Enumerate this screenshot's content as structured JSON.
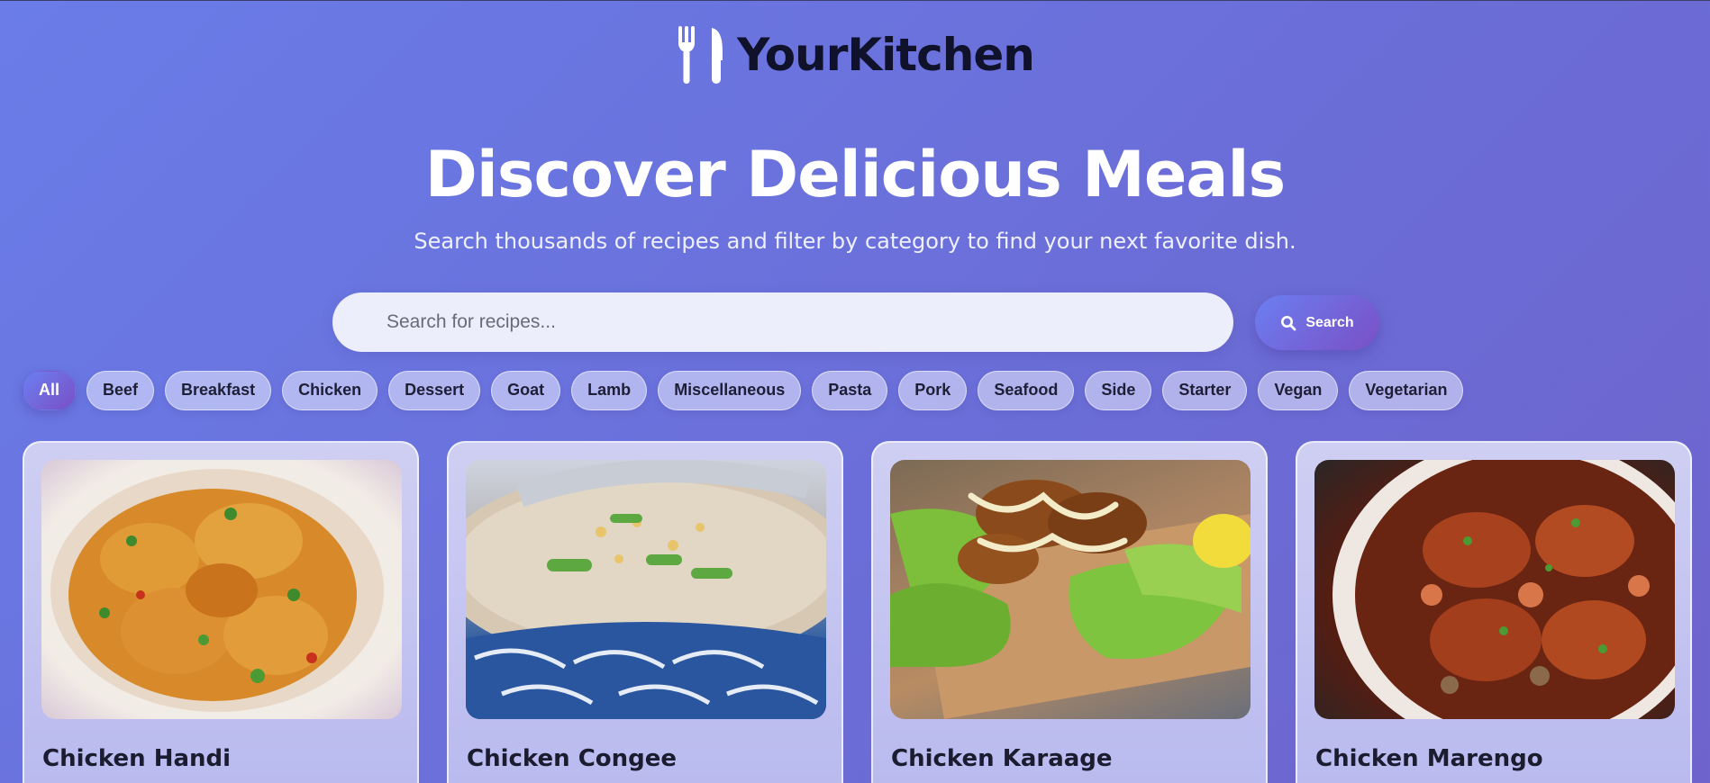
{
  "brand": {
    "name": "YourKitchen",
    "icon": "fork-knife-icon"
  },
  "hero": {
    "title": "Discover Delicious Meals",
    "subtitle": "Search thousands of recipes and filter by category to find your next favorite dish."
  },
  "search": {
    "placeholder": "Search for recipes...",
    "value": "",
    "button_label": "Search",
    "icon": "search-icon"
  },
  "categories": {
    "active": "All",
    "items": [
      "All",
      "Beef",
      "Breakfast",
      "Chicken",
      "Dessert",
      "Goat",
      "Lamb",
      "Miscellaneous",
      "Pasta",
      "Pork",
      "Seafood",
      "Side",
      "Starter",
      "Vegan",
      "Vegetarian"
    ]
  },
  "recipes": [
    {
      "title": "Chicken Handi"
    },
    {
      "title": "Chicken Congee"
    },
    {
      "title": "Chicken Karaage"
    },
    {
      "title": "Chicken Marengo"
    }
  ],
  "colors": {
    "accent_start": "#6b7ff0",
    "accent_end": "#7a4fc6",
    "background": "#6b6ed8"
  }
}
